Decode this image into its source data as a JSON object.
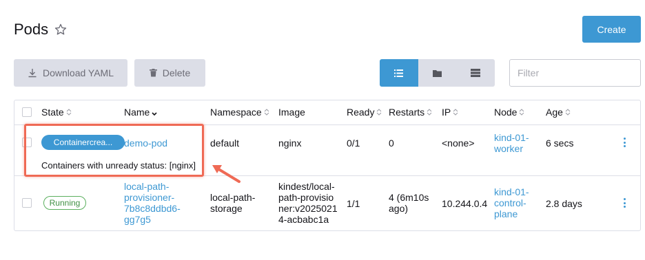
{
  "page": {
    "title": "Pods"
  },
  "toolbar": {
    "create_label": "Create",
    "download_label": "Download YAML",
    "delete_label": "Delete",
    "filter_placeholder": "Filter"
  },
  "table": {
    "columns": [
      "State",
      "Name",
      "Namespace",
      "Image",
      "Ready",
      "Restarts",
      "IP",
      "Node",
      "Age"
    ],
    "rows": [
      {
        "state": "Containercrea...",
        "name": "demo-pod",
        "namespace": "default",
        "image": "nginx",
        "ready": "0/1",
        "restarts": "0",
        "ip": "<none>",
        "node_line1": "kind-01-",
        "node_line2": "worker",
        "age": "6 secs",
        "detail": "Containers with unready status: [nginx]"
      },
      {
        "state": "Running",
        "name_line1": "local-path-",
        "name_line2": "provisioner-",
        "name_line3": "7b8c8ddbd6-",
        "name_line4": "gg7g5",
        "namespace_line1": "local-path-",
        "namespace_line2": "storage",
        "image_line1": "kindest/local-",
        "image_line2": "path-provisio",
        "image_line3": "ner:v2025021",
        "image_line4": "4-acbabc1a",
        "ready": "1/1",
        "restarts_line1": "4 (6m10s",
        "restarts_line2": "ago)",
        "ip": "10.244.0.4",
        "node_line1": "kind-01-",
        "node_line2": "control-",
        "node_line3": "plane",
        "age": "2.8 days"
      }
    ]
  },
  "colors": {
    "accent": "#3d98d3",
    "running": "#5aaf5d",
    "highlight": "#ef6a55"
  },
  "icons": [
    "star-icon",
    "download-icon",
    "trash-icon",
    "list-view-icon",
    "folder-view-icon",
    "group-view-icon",
    "sort-icon",
    "kebab-menu-icon",
    "annotation-arrow"
  ]
}
